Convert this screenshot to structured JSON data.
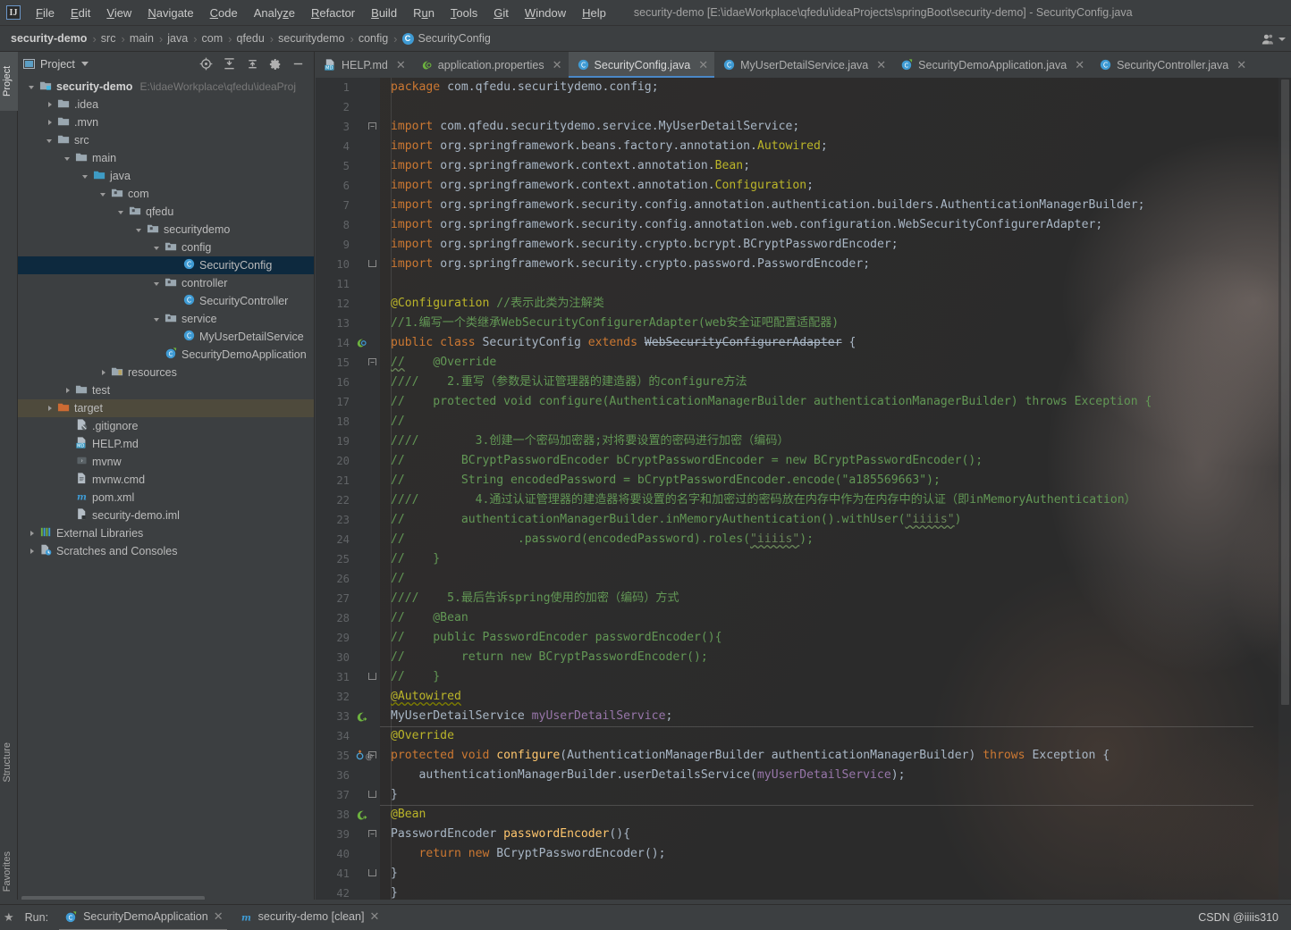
{
  "window": {
    "title": "security-demo [E:\\idaeWorkplace\\qfedu\\ideaProjects\\springBoot\\security-demo] - SecurityConfig.java",
    "logo": "IJ"
  },
  "menubar": {
    "items": [
      {
        "label": "File",
        "mnemonic": "F"
      },
      {
        "label": "Edit",
        "mnemonic": "E"
      },
      {
        "label": "View",
        "mnemonic": "V"
      },
      {
        "label": "Navigate",
        "mnemonic": "N"
      },
      {
        "label": "Code",
        "mnemonic": "C"
      },
      {
        "label": "Analyze",
        "mnemonic": "z"
      },
      {
        "label": "Refactor",
        "mnemonic": "R"
      },
      {
        "label": "Build",
        "mnemonic": "B"
      },
      {
        "label": "Run",
        "mnemonic": "u"
      },
      {
        "label": "Tools",
        "mnemonic": "T"
      },
      {
        "label": "Git",
        "mnemonic": "G"
      },
      {
        "label": "Window",
        "mnemonic": "W"
      },
      {
        "label": "Help",
        "mnemonic": "H"
      }
    ]
  },
  "breadcrumb": {
    "items": [
      "security-demo",
      "src",
      "main",
      "java",
      "com",
      "qfedu",
      "securitydemo",
      "config"
    ],
    "current": "SecurityConfig",
    "current_icon": "C"
  },
  "toolstrip": {
    "project_tab": "Project",
    "structure_tab": "Structure",
    "favorites_tab": "Favorites"
  },
  "project_panel": {
    "title": "Project",
    "tools": [
      "locate-icon",
      "expand-all-icon",
      "collapse-all-icon",
      "gear-icon",
      "hide-icon"
    ],
    "tree": [
      {
        "depth": 0,
        "arrow": "down",
        "icon": "module",
        "label": "security-demo",
        "bold": true,
        "path": "E:\\idaeWorkplace\\qfedu\\ideaProj"
      },
      {
        "depth": 1,
        "arrow": "right",
        "icon": "folder",
        "label": ".idea"
      },
      {
        "depth": 1,
        "arrow": "right",
        "icon": "folder",
        "label": ".mvn"
      },
      {
        "depth": 1,
        "arrow": "down",
        "icon": "folder",
        "label": "src"
      },
      {
        "depth": 2,
        "arrow": "down",
        "icon": "folder",
        "label": "main"
      },
      {
        "depth": 3,
        "arrow": "down",
        "icon": "folder-src",
        "label": "java"
      },
      {
        "depth": 4,
        "arrow": "down",
        "icon": "package",
        "label": "com"
      },
      {
        "depth": 5,
        "arrow": "down",
        "icon": "package",
        "label": "qfedu"
      },
      {
        "depth": 6,
        "arrow": "down",
        "icon": "package",
        "label": "securitydemo"
      },
      {
        "depth": 7,
        "arrow": "down",
        "icon": "package",
        "label": "config"
      },
      {
        "depth": 8,
        "arrow": "none",
        "icon": "class",
        "label": "SecurityConfig",
        "selected": true
      },
      {
        "depth": 7,
        "arrow": "down",
        "icon": "package",
        "label": "controller"
      },
      {
        "depth": 8,
        "arrow": "none",
        "icon": "class",
        "label": "SecurityController"
      },
      {
        "depth": 7,
        "arrow": "down",
        "icon": "package",
        "label": "service"
      },
      {
        "depth": 8,
        "arrow": "none",
        "icon": "class",
        "label": "MyUserDetailService"
      },
      {
        "depth": 7,
        "arrow": "none",
        "icon": "spring-class",
        "label": "SecurityDemoApplication"
      },
      {
        "depth": 4,
        "arrow": "right",
        "icon": "folder-res",
        "label": "resources"
      },
      {
        "depth": 2,
        "arrow": "right",
        "icon": "folder",
        "label": "test"
      },
      {
        "depth": 1,
        "arrow": "right",
        "icon": "folder-excl",
        "label": "target",
        "dim_selected": true
      },
      {
        "depth": 2,
        "arrow": "none",
        "icon": "gitignore",
        "label": ".gitignore"
      },
      {
        "depth": 2,
        "arrow": "none",
        "icon": "markdown",
        "label": "HELP.md"
      },
      {
        "depth": 2,
        "arrow": "none",
        "icon": "script",
        "label": "mvnw"
      },
      {
        "depth": 2,
        "arrow": "none",
        "icon": "file",
        "label": "mvnw.cmd"
      },
      {
        "depth": 2,
        "arrow": "none",
        "icon": "maven",
        "label": "pom.xml"
      },
      {
        "depth": 2,
        "arrow": "none",
        "icon": "iml",
        "label": "security-demo.iml"
      },
      {
        "depth": 0,
        "arrow": "right",
        "icon": "libraries",
        "label": "External Libraries"
      },
      {
        "depth": 0,
        "arrow": "right",
        "icon": "scratches",
        "label": "Scratches and Consoles"
      }
    ]
  },
  "editor_tabs": [
    {
      "label": "HELP.md",
      "icon": "markdown",
      "active": false
    },
    {
      "label": "application.properties",
      "icon": "spring",
      "active": false
    },
    {
      "label": "SecurityConfig.java",
      "icon": "class",
      "active": true
    },
    {
      "label": "MyUserDetailService.java",
      "icon": "class",
      "active": false
    },
    {
      "label": "SecurityDemoApplication.java",
      "icon": "spring-class",
      "active": false
    },
    {
      "label": "SecurityController.java",
      "icon": "class",
      "active": false
    }
  ],
  "code": {
    "lines": [
      {
        "n": 1,
        "html": "<span class=\"kw\">package</span> <span class=\"txt\">com.qfedu.securitydemo.config;</span>"
      },
      {
        "n": 2,
        "html": ""
      },
      {
        "n": 3,
        "html": "<span class=\"kw\">import</span> <span class=\"txt\">com.qfedu.securitydemo.service.</span><span class=\"cls\">MyUserDetailService</span><span class=\"txt\">;</span>",
        "fold": "top"
      },
      {
        "n": 4,
        "html": "<span class=\"kw\">import</span> <span class=\"txt\">org.springframework.beans.factory.annotation.</span><span class=\"ann\">Autowired</span><span class=\"txt\">;</span>"
      },
      {
        "n": 5,
        "html": "<span class=\"kw\">import</span> <span class=\"txt\">org.springframework.context.annotation.</span><span class=\"ann\">Bean</span><span class=\"txt\">;</span>"
      },
      {
        "n": 6,
        "html": "<span class=\"kw\">import</span> <span class=\"txt\">org.springframework.context.annotation.</span><span class=\"ann\">Configuration</span><span class=\"txt\">;</span>"
      },
      {
        "n": 7,
        "html": "<span class=\"kw\">import</span> <span class=\"txt\">org.springframework.security.config.annotation.authentication.builders.</span><span class=\"cls\">AuthenticationManagerBuilder</span><span class=\"txt\">;</span>"
      },
      {
        "n": 8,
        "html": "<span class=\"kw\">import</span> <span class=\"txt\">org.springframework.security.config.annotation.web.configuration.</span><span class=\"cls\">WebSecurityConfigurerAdapter</span><span class=\"txt\">;</span>"
      },
      {
        "n": 9,
        "html": "<span class=\"kw\">import</span> <span class=\"txt\">org.springframework.security.crypto.bcrypt.</span><span class=\"cls\">BCryptPasswordEncoder</span><span class=\"txt\">;</span>"
      },
      {
        "n": 10,
        "html": "<span class=\"kw\">import</span> <span class=\"txt\">org.springframework.security.crypto.password.</span><span class=\"cls\">PasswordEncoder</span><span class=\"txt\">;</span>",
        "fold": "bot"
      },
      {
        "n": 11,
        "html": ""
      },
      {
        "n": 12,
        "html": "<span class=\"ann\">@Configuration</span> <span class=\"cmt\">//表示此类为注解类</span>"
      },
      {
        "n": 13,
        "html": "<span class=\"cmt\">//1.编写一个类继承WebSecurityConfigurerAdapter(web安全证吧配置适配器)</span>"
      },
      {
        "n": 14,
        "html": "<span class=\"kw\">public class</span> <span class=\"cls\">SecurityConfig</span> <span class=\"kw\">extends</span> <span class=\"cls strike\">WebSecurityConfigurerAdapter</span> <span class=\"txt\">{</span>",
        "gmark": "spring-bean"
      },
      {
        "n": 15,
        "html": "<span class=\"cmt squiggle-g\">//</span><span class=\"cmt\">    @Override</span>",
        "fold": "top"
      },
      {
        "n": 16,
        "html": "<span class=\"cmt\">////    2.重写（参数是认证管理器的建造器）的configure方法</span>"
      },
      {
        "n": 17,
        "html": "<span class=\"cmt\">//    protected void configure(AuthenticationManagerBuilder authenticationManagerBuilder) throws Exception {</span>"
      },
      {
        "n": 18,
        "html": "<span class=\"cmt\">//</span>"
      },
      {
        "n": 19,
        "html": "<span class=\"cmt\">////        3.创建一个密码加密器;对将要设置的密码进行加密（编码）</span>"
      },
      {
        "n": 20,
        "html": "<span class=\"cmt\">//        BCryptPasswordEncoder bCryptPasswordEncoder = new BCryptPasswordEncoder();</span>"
      },
      {
        "n": 21,
        "html": "<span class=\"cmt\">//        String encodedPassword = bCryptPasswordEncoder.encode(\"a185569663\");</span>"
      },
      {
        "n": 22,
        "html": "<span class=\"cmt\">////        4.通过认证管理器的建造器将要设置的名字和加密过的密码放在内存中作为在内存中的认证（即inMemoryAuthentication）</span>"
      },
      {
        "n": 23,
        "html": "<span class=\"cmt\">//        authenticationManagerBuilder.inMemoryAuthentication().withUser(</span><span class=\"str squiggle-g\">\"iiiis\"</span><span class=\"cmt\">)</span>"
      },
      {
        "n": 24,
        "html": "<span class=\"cmt\">//                .password(encodedPassword).roles(</span><span class=\"str squiggle-g\">\"iiiis\"</span><span class=\"cmt\">);</span>"
      },
      {
        "n": 25,
        "html": "<span class=\"cmt\">//    }</span>"
      },
      {
        "n": 26,
        "html": "<span class=\"cmt\">//</span>"
      },
      {
        "n": 27,
        "html": "<span class=\"cmt\">////    5.最后告诉spring使用的加密（编码）方式</span>"
      },
      {
        "n": 28,
        "html": "<span class=\"cmt\">//    @Bean</span>"
      },
      {
        "n": 29,
        "html": "<span class=\"cmt\">//    public PasswordEncoder passwordEncoder(){</span>"
      },
      {
        "n": 30,
        "html": "<span class=\"cmt\">//        return new BCryptPasswordEncoder();</span>"
      },
      {
        "n": 31,
        "html": "<span class=\"cmt\">//    }</span>",
        "fold": "bot"
      },
      {
        "n": 32,
        "html": "<span class=\"ann squiggle\">@Autowired</span>"
      },
      {
        "n": 33,
        "html": "<span class=\"cls\">MyUserDetailService</span> <span class=\"fld\">myUserDetailService</span><span class=\"txt\">;</span>",
        "gmark": "bean-green"
      },
      {
        "n": 34,
        "html": "<span class=\"ann\">@Override</span>",
        "sep_above": true
      },
      {
        "n": 35,
        "html": "<span class=\"kw\">protected void</span> <span class=\"mth\">configure</span><span class=\"txt\">(</span><span class=\"cls\">AuthenticationManagerBuilder</span> <span class=\"txt\">authenticationManagerBuilder)</span> <span class=\"kw\">throws</span> <span class=\"cls\">Exception</span> <span class=\"txt\">{</span>",
        "gmark": "override",
        "fold": "top"
      },
      {
        "n": 36,
        "html": "<span class=\"txt\">    authenticationManagerBuilder.userDetailsService(</span><span class=\"fld\">myUserDetailService</span><span class=\"txt\">);</span>"
      },
      {
        "n": 37,
        "html": "<span class=\"txt\">}</span>",
        "fold": "bot"
      },
      {
        "n": 38,
        "html": "<span class=\"ann\">@Bean</span>",
        "gmark": "bean-leaf",
        "sep_above": true
      },
      {
        "n": 39,
        "html": "<span class=\"cls\">PasswordEncoder</span> <span class=\"mth\">passwordEncoder</span><span class=\"txt\">(){</span>",
        "fold": "top"
      },
      {
        "n": 40,
        "html": "<span class=\"kw\">    return new</span> <span class=\"cls\">BCryptPasswordEncoder</span><span class=\"txt\">();</span>"
      },
      {
        "n": 41,
        "html": "<span class=\"txt\">}</span>",
        "fold": "bot"
      },
      {
        "n": 42,
        "html": "<span class=\"txt\">}</span>",
        "noindent": true
      }
    ]
  },
  "statusbar": {
    "run_label": "Run:",
    "tabs": [
      {
        "label": "SecurityDemoApplication",
        "icon": "spring-class",
        "active": true
      },
      {
        "label": "security-demo [clean]",
        "icon": "maven",
        "active": false
      }
    ],
    "watermark": "CSDN @iiiis310"
  },
  "colors": {
    "accent": "#4a88c7",
    "panel_bg": "#3c3f41",
    "editor_bg": "#2b2b2b",
    "gutter_bg": "#313335",
    "selection": "#0d293e",
    "keyword": "#cc7832",
    "comment": "#629755",
    "string": "#6a8759",
    "annotation": "#bbb529",
    "field": "#9876aa",
    "method": "#ffc66d"
  }
}
